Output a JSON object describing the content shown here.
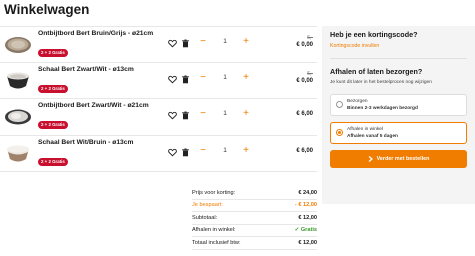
{
  "page": {
    "title": "Winkelwagen"
  },
  "colors": {
    "accent": "#f07c00",
    "badge": "#c8102e",
    "free": "#3a9a2e"
  },
  "cart": {
    "items": [
      {
        "name": "Ontbijtbord Bert Bruin/Grijs - ø21cm",
        "badge": "2 + 2 Gratis",
        "qty": "1",
        "price_old": "6,-",
        "price": "€ 0,00",
        "thumb": "plate-brown-grey"
      },
      {
        "name": "Schaal Bert Zwart/Wit - ø13cm",
        "badge": "2 + 2 Gratis",
        "qty": "1",
        "price_old": "6,-",
        "price": "€ 0,00",
        "thumb": "bowl-black-white"
      },
      {
        "name": "Ontbijtbord Bert Zwart/Wit - ø21cm",
        "badge": "2 + 2 Gratis",
        "qty": "1",
        "price_old": "",
        "price": "€ 6,00",
        "thumb": "plate-black-white"
      },
      {
        "name": "Schaal Bert Wit/Bruin - ø13cm",
        "badge": "2 + 2 Gratis",
        "qty": "1",
        "price_old": "",
        "price": "€ 6,00",
        "thumb": "bowl-white-brown"
      }
    ],
    "icons": {
      "favorite": "heart-icon",
      "delete": "trash-icon",
      "decrease": "minus-icon",
      "increase": "plus-icon"
    }
  },
  "totals": [
    {
      "label": "Prijs voor korting:",
      "value": "€ 24,00"
    },
    {
      "label": "Je bespaart:",
      "value": "- € 12,00"
    },
    {
      "label": "Subtotaal:",
      "value": "€ 12,00"
    },
    {
      "label": "Afhalen in winkel:",
      "value": "✓ Gratis"
    },
    {
      "label": "Totaal inclusief btw:",
      "value": "€ 12,00"
    }
  ],
  "sidebar": {
    "discount_title": "Heb je een kortingscode?",
    "discount_link": "Kortingscode invullen",
    "delivery_title": "Afhalen of laten bezorgen?",
    "delivery_subtitle": "Je kunt dit later in het bestelproces nog wijzigen",
    "options": [
      {
        "label": "Bezorgen",
        "detail": "Binnen 2-3 werkdagen bezorgd",
        "selected": false
      },
      {
        "label": "Afhalen in winkel",
        "detail": "Afhalen vanaf 5 dagen",
        "selected": true
      }
    ],
    "cta": "Verder met bestellen",
    "cta_icon": "chevron-right-icon"
  }
}
